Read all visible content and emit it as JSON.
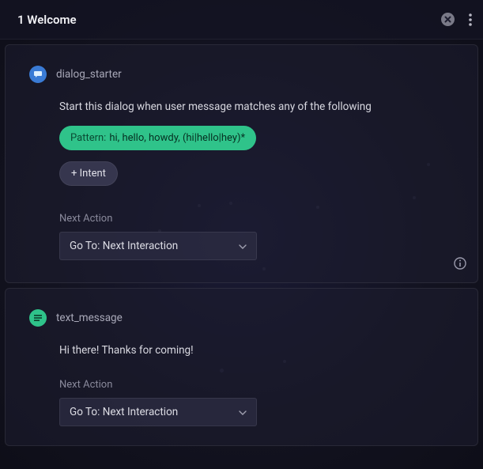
{
  "header": {
    "title": "1 Welcome"
  },
  "node_dialog": {
    "type_label": "dialog_starter",
    "description": "Start this dialog when user message matches any of the following",
    "pattern_key": "Pattern:",
    "pattern_value": "hi, hello, howdy, (hi|hello|hey)*",
    "add_intent_label": "+ Intent",
    "next_action_label": "Next Action",
    "next_action_value": "Go To: Next Interaction"
  },
  "node_text": {
    "type_label": "text_message",
    "message": "Hi there! Thanks for coming!",
    "next_action_label": "Next Action",
    "next_action_value": "Go To: Next Interaction"
  }
}
